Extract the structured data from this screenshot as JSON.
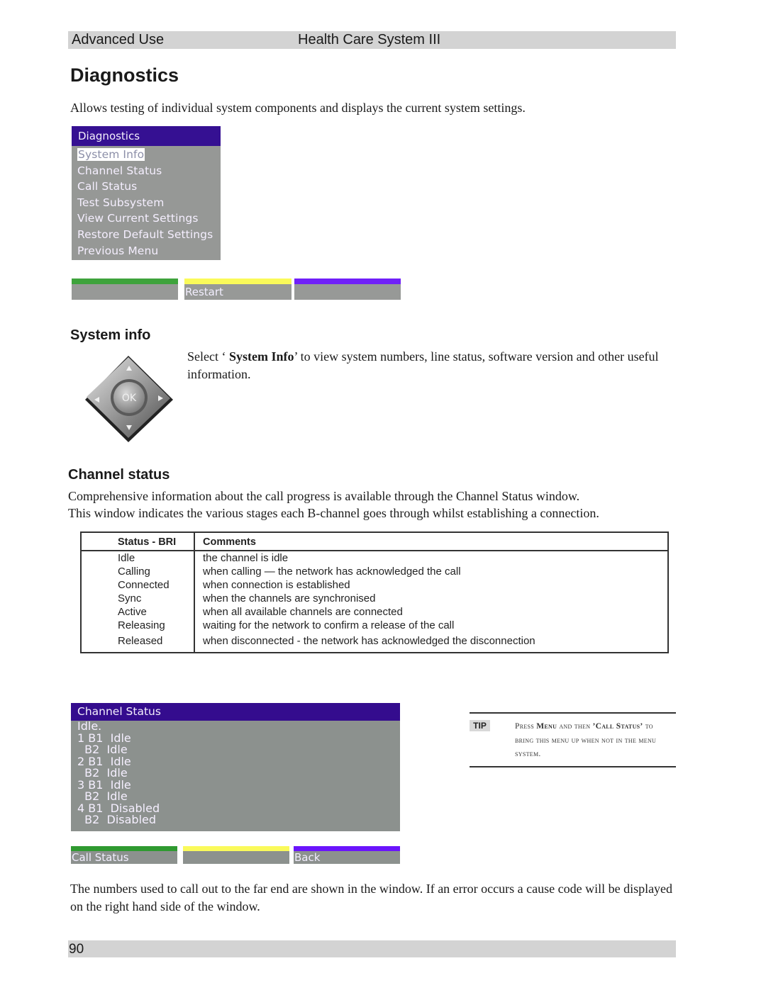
{
  "header": {
    "section": "Advanced Use",
    "product": "Health Care System III"
  },
  "page_title": "Diagnostics",
  "intro": "Allows testing of individual system components and displays the current system settings.",
  "diagnostics_menu": {
    "title": "Diagnostics",
    "selected_index": 0,
    "items": [
      "System Info",
      "Channel Status",
      "Call Status",
      "Test Subsystem",
      "View Current Settings",
      "Restore Default Settings",
      "Previous Menu"
    ],
    "softkeys": [
      {
        "color": "#3ea33c",
        "label": ""
      },
      {
        "color": "#fafa5a",
        "label": "Restart"
      },
      {
        "color": "#7020f8",
        "label": ""
      }
    ]
  },
  "system_info": {
    "heading": "System info",
    "text_before": "Select ‘ ",
    "text_bold": "System Info",
    "text_after": "’ to view system numbers, line status, software version and other useful information.",
    "remote_icon_label": "OK"
  },
  "channel_status": {
    "heading": "Channel status",
    "para1": "Comprehensive information about the call progress is available through the Channel Status window.",
    "para2": "This window indicates the various stages each B-channel goes through whilst establishing a connection.",
    "table": {
      "headers": [
        "Status - BRI",
        "Comments"
      ],
      "rows": [
        [
          "Idle",
          "the channel is idle"
        ],
        [
          "Calling",
          "when calling — the network has acknowledged the call"
        ],
        [
          "Connected",
          "when connection is established"
        ],
        [
          "Sync",
          "when the channels are synchronised"
        ],
        [
          "Active",
          "when all available channels are connected"
        ],
        [
          "Releasing",
          "waiting for the network to confirm a release of the call"
        ],
        [
          "Released",
          "when disconnected - the network has acknowledged the disconnection"
        ]
      ]
    }
  },
  "channel_status_window": {
    "title": "Channel Status",
    "lines": [
      "Idle.",
      "1 B1  Idle",
      "  B2  Idle",
      "2 B1  Idle",
      "  B2  Idle",
      "3 B1  Idle",
      "  B2  Idle",
      "4 B1  Disabled",
      "  B2  Disabled"
    ],
    "softkeys": [
      {
        "color": "#2f9a30",
        "label": "Call Status"
      },
      {
        "color": "#fafa5a",
        "label": ""
      },
      {
        "color": "#6a14fc",
        "label": "Back"
      }
    ]
  },
  "tip": {
    "badge": "TIP",
    "part1": "Press ",
    "bold1": "Menu",
    "part2": " and then ",
    "bold2": "’Call Status’",
    "part3": " to bring this menu up when not in the menu system."
  },
  "closing_text": "The numbers used to call out to the far end are shown in the window. If an error occurs a cause code will be displayed on the right hand side of the window.",
  "footer": {
    "page_number": "90"
  }
}
